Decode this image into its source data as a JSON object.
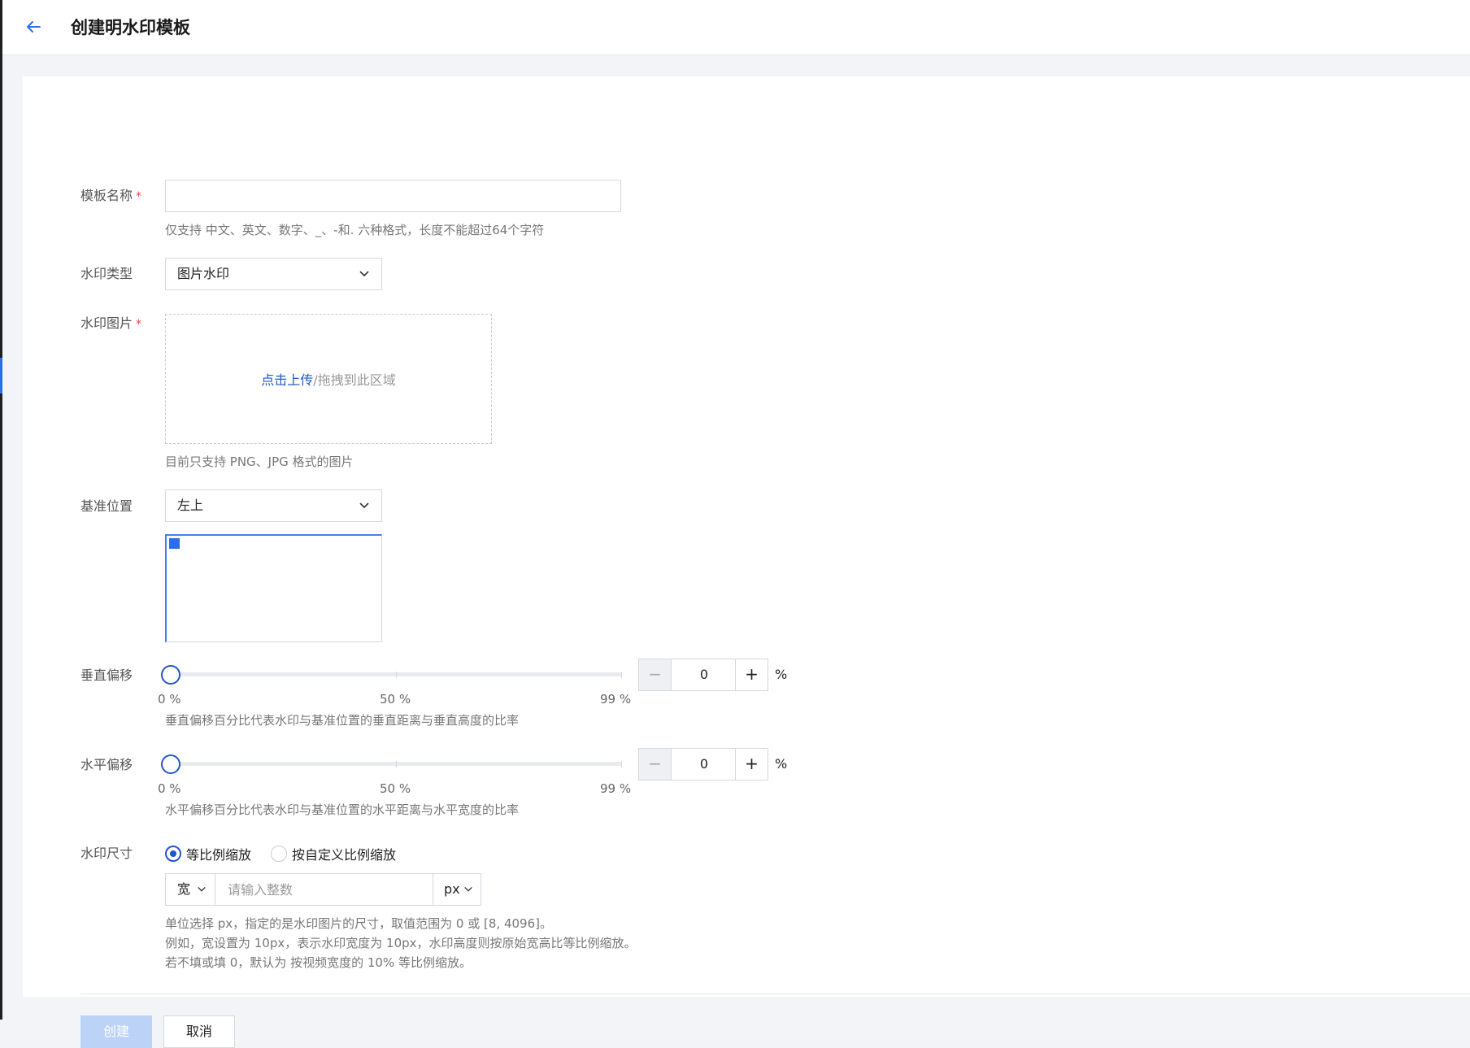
{
  "header": {
    "title": "创建明水印模板"
  },
  "form": {
    "name": {
      "label": "模板名称",
      "required_mark": "*",
      "value": "",
      "help": "仅支持 中文、英文、数字、_、-和. 六种格式，长度不能超过64个字符"
    },
    "type": {
      "label": "水印类型",
      "selected": "图片水印"
    },
    "image": {
      "label": "水印图片",
      "required_mark": "*",
      "upload_link": "点击上传",
      "upload_hint": "/拖拽到此区域",
      "help": "目前只支持 PNG、JPG 格式的图片"
    },
    "position": {
      "label": "基准位置",
      "selected": "左上"
    },
    "vertical_offset": {
      "label": "垂直偏移",
      "value": "0",
      "level": 0,
      "marks": [
        "0 %",
        "50 %",
        "99 %"
      ],
      "unit": "%",
      "minus": "−",
      "plus": "+",
      "help": "垂直偏移百分比代表水印与基准位置的垂直距离与垂直高度的比率"
    },
    "horizontal_offset": {
      "label": "水平偏移",
      "value": "0",
      "level": 0,
      "marks": [
        "0 %",
        "50 %",
        "99 %"
      ],
      "unit": "%",
      "minus": "−",
      "plus": "+",
      "help": "水平偏移百分比代表水印与基准位置的水平距离与水平宽度的比率"
    },
    "size": {
      "label": "水印尺寸",
      "options": [
        "等比例缩放",
        "按自定义比例缩放"
      ],
      "selected_index": 0,
      "dimension": "宽",
      "placeholder": "请输入整数",
      "unit": "px",
      "help_lines": [
        "单位选择 px，指定的是水印图片的尺寸，取值范围为 0 或 [8, 4096]。",
        "例如，宽设置为 10px，表示水印宽度为 10px，水印高度则按原始宽高比等比例缩放。",
        "若不填或填 0，默认为 按视频宽度的 10% 等比例缩放。"
      ]
    }
  },
  "actions": {
    "create": "创建",
    "cancel": "取消"
  },
  "colors": {
    "primary": "#2057c8",
    "marker": "#2b6fe8",
    "required": "#e54545"
  }
}
